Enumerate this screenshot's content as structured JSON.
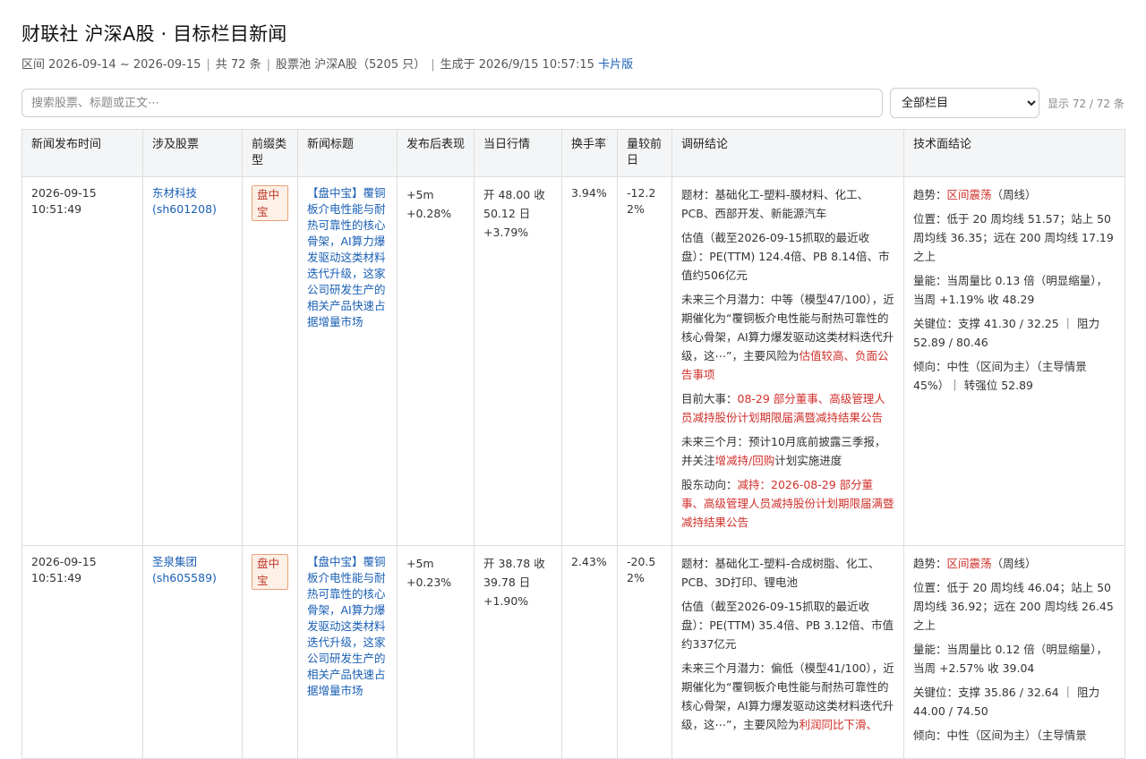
{
  "header": {
    "title": "财联社 沪深A股 · 目标栏目新闻",
    "range": "区间 2026-09-14 ~ 2026-09-15",
    "total": "共 72 条",
    "pool": "股票池 沪深A股（5205 只）",
    "generated": "生成于 2026/9/15 10:57:15",
    "card_link": "卡片版"
  },
  "toolbar": {
    "search_placeholder": "搜索股票、标题或正文⋯",
    "select_value": "全部栏目",
    "count": "显示 72 / 72 条"
  },
  "columns": [
    "新闻发布时间",
    "涉及股票",
    "前缀类型",
    "新闻标题",
    "发布后表现",
    "当日行情",
    "换手率",
    "量较前日",
    "调研结论",
    "技术面结论"
  ],
  "rows": [
    {
      "time": "2026-09-15 10:51:49",
      "stock": "东材科技 (sh601208)",
      "tag": "盘中宝",
      "title": "【盘中宝】覆铜板介电性能与耐热可靠性的核心骨架，AI算力爆发驱动这类材料迭代升级，这家公司研发生产的相关产品快速占据增量市场",
      "perf1": "+5m",
      "perf2": "+0.28%",
      "market": "开 48.00 收 50.12 日 +3.79%",
      "turnover": "3.94%",
      "volume": "-12.22%",
      "r_topic": "题材：基础化工-塑料-膜材料、化工、PCB、西部开发、新能源汽车",
      "r_value": "估值（截至2026-09-15抓取的最近收盘）：PE(TTM) 124.4倍、PB 8.14倍、市值约506亿元",
      "r_potential": "未来三个月潜力：中等（模型47/100），近期催化为“覆铜板介电性能与耐热可靠性的核心骨架，AI算力爆发驱动这类材料迭代升级，这⋯”，主要风险为",
      "r_risk1": "估值较高",
      "r_risk_sep": "、",
      "r_risk2": "负面公告事项",
      "r_event_label": "目前大事：",
      "r_event": "08-29 部分董事、高级管理人员减持股份计划期限届满暨减持结果公告",
      "r_next_a": "未来三个月：预计10月底前披露三季报，并关注",
      "r_next_red": "增减持/回购",
      "r_next_b": "计划实施进度",
      "r_holder_label": "股东动向：",
      "r_holder": "减持：2026-08-29 部分董事、高级管理人员减持股份计划期限届满暨减持结果公告",
      "t_trend_label": "趋势：",
      "t_trend": "区间震荡",
      "t_trend_suffix": "（周线）",
      "t_position": "位置：低于 20 周均线 51.57；站上 50 周均线 36.35；远在 200 周均线 17.19 之上",
      "t_volume": "量能：当周量比 0.13 倍（明显缩量），当周 +1.19% 收 48.29",
      "t_key": "关键位：支撑 41.30 / 32.25 ｜ 阻力 52.89 / 80.46",
      "t_bias": "倾向：中性（区间为主）（主导情景 45%）｜ 转强位 52.89"
    },
    {
      "time": "2026-09-15 10:51:49",
      "stock": "圣泉集团 (sh605589)",
      "tag": "盘中宝",
      "title": "【盘中宝】覆铜板介电性能与耐热可靠性的核心骨架，AI算力爆发驱动这类材料迭代升级，这家公司研发生产的相关产品快速占据增量市场",
      "perf1": "+5m",
      "perf2": "+0.23%",
      "market": "开 38.78 收 39.78 日 +1.90%",
      "turnover": "2.43%",
      "volume": "-20.52%",
      "r_topic": "题材：基础化工-塑料-合成树脂、化工、PCB、3D打印、锂电池",
      "r_value": "估值（截至2026-09-15抓取的最近收盘）：PE(TTM) 35.4倍、PB 3.12倍、市值约337亿元",
      "r_potential": "未来三个月潜力：偏低（模型41/100），近期催化为“覆铜板介电性能与耐热可靠性的核心骨架，AI算力爆发驱动这类材料迭代升级，这⋯”，主要风险为",
      "r_risk1": "利润同比下滑",
      "r_risk_sep": "、",
      "t_trend_label": "趋势：",
      "t_trend": "区间震荡",
      "t_trend_suffix": "（周线）",
      "t_position": "位置：低于 20 周均线 46.04；站上 50 周均线 36.92；远在 200 周均线 26.45 之上",
      "t_volume": "量能：当周量比 0.12 倍（明显缩量），当周 +2.57% 收 39.04",
      "t_key": "关键位：支撑 35.86 / 32.64 ｜ 阻力 44.00 / 74.50",
      "t_bias": "倾向：中性（区间为主）（主导情景"
    }
  ],
  "colors": {
    "link": "#1a5fb4",
    "risk": "#d0302b",
    "tag_bg": "#fdf0e6",
    "tag_border": "#e8a07a"
  }
}
